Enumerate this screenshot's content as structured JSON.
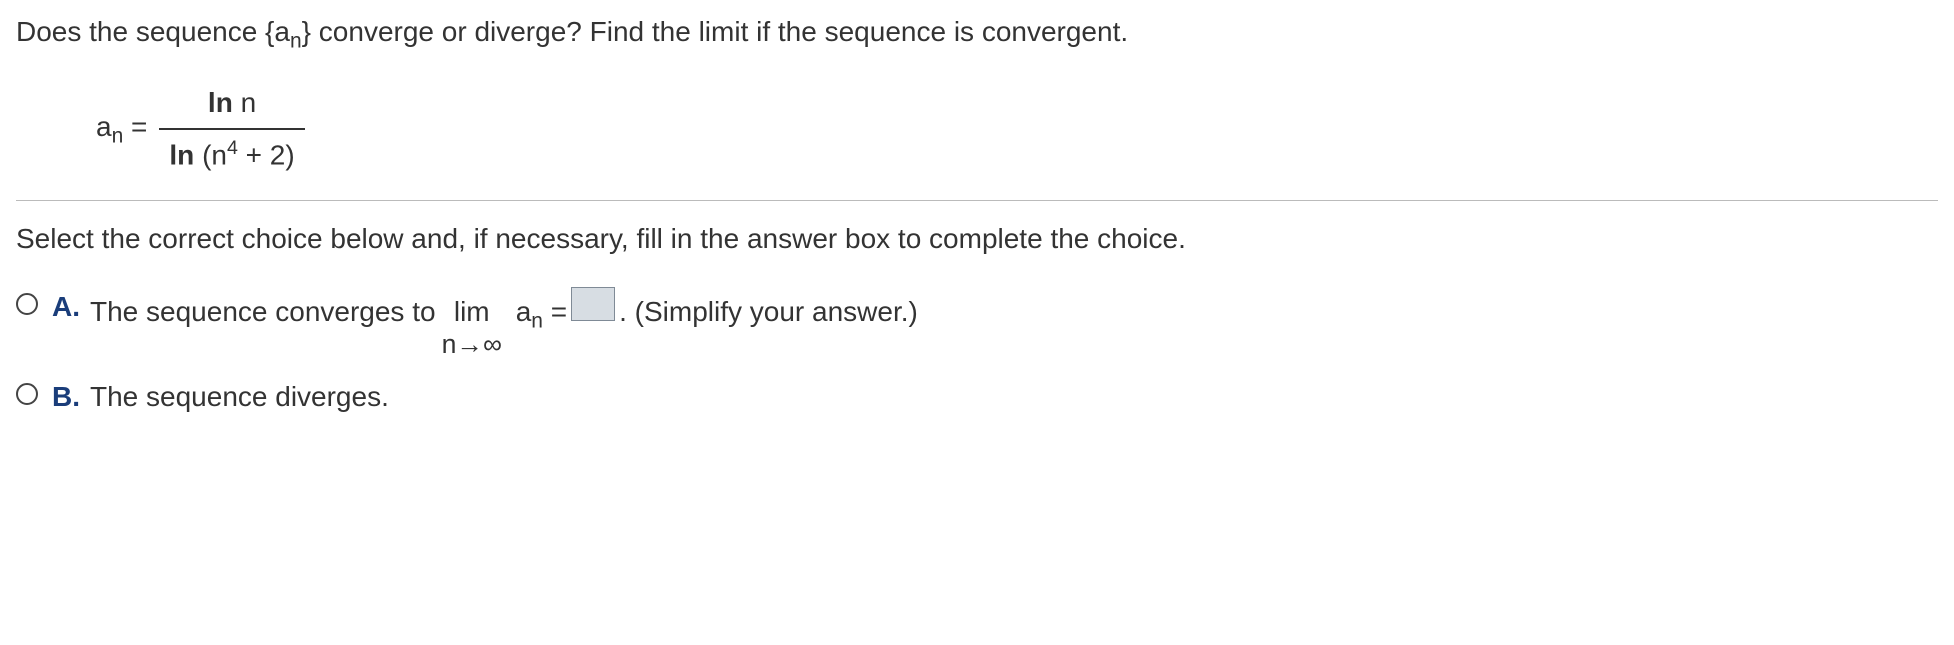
{
  "question": {
    "prompt_prefix": "Does the sequence {a",
    "prompt_sub": "n",
    "prompt_suffix": "} converge or diverge? Find the limit if the sequence is convergent."
  },
  "formula": {
    "lhs_a": "a",
    "lhs_sub": "n",
    "eq": " = ",
    "numerator_ln": "ln",
    "numerator_arg": " n",
    "denominator_ln": "ln",
    "denominator_open": " (n",
    "denominator_exp": "4",
    "denominator_close": " + 2)"
  },
  "instruction": "Select the correct choice below and, if necessary, fill in the answer box to complete the choice.",
  "choices": {
    "a": {
      "label": "A.",
      "text_before": "The sequence converges to ",
      "lim": "lim",
      "lim_sub": "n→∞",
      "anlhs_a": "a",
      "anlhs_sub": "n",
      "eq": " = ",
      "text_after": " .  (Simplify your answer.)"
    },
    "b": {
      "label": "B.",
      "text": "The sequence diverges."
    }
  }
}
